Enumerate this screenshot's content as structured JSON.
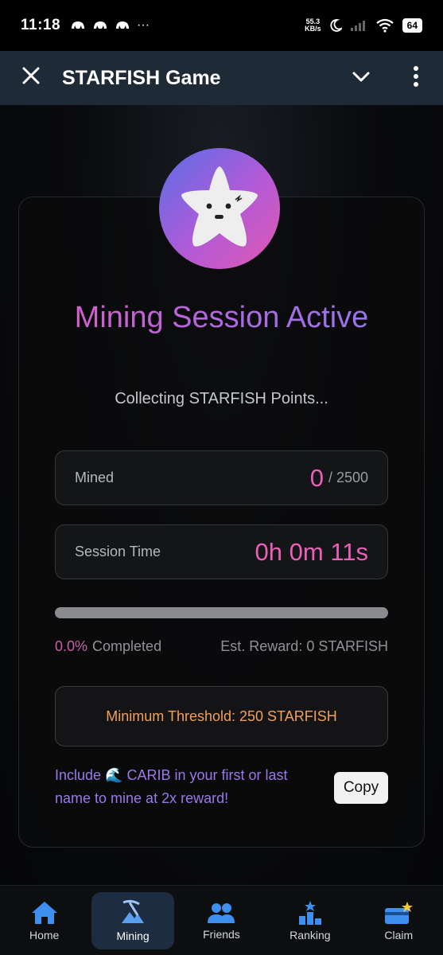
{
  "status_bar": {
    "time": "11:18",
    "notifications": [
      "app-icon",
      "app-icon",
      "app-icon"
    ],
    "more": "···",
    "net_speed_value": "55.3",
    "net_speed_unit": "KB/s",
    "battery": "64"
  },
  "header": {
    "title": "STARFISH Game"
  },
  "main": {
    "headline": "Mining Session Active",
    "subtitle": "Collecting STARFISH Points...",
    "mined": {
      "label": "Mined",
      "value": "0",
      "total": "/ 2500"
    },
    "session_time": {
      "label": "Session Time",
      "value": "0h 0m 11s"
    },
    "progress": {
      "fraction": 0.0,
      "percent_label": "0.0%",
      "completed_label": "Completed",
      "est_reward_label": "Est. Reward: 0 STARFISH"
    },
    "threshold": "Minimum Threshold: 250 STARFISH",
    "promo_text": "Include 🌊 CARIB in your first or last name to mine at 2x reward!",
    "copy_button": "Copy"
  },
  "bottom_nav": [
    {
      "label": "Home",
      "icon": "home-icon",
      "active": false
    },
    {
      "label": "Mining",
      "icon": "mining-icon",
      "active": true
    },
    {
      "label": "Friends",
      "icon": "friends-icon",
      "active": false
    },
    {
      "label": "Ranking",
      "icon": "ranking-icon",
      "active": false
    },
    {
      "label": "Claim",
      "icon": "claim-icon",
      "active": false
    }
  ],
  "colors": {
    "accent_pink": "#ec5fb8",
    "accent_purple": "#9a78ec",
    "threshold_orange": "#f0a05a",
    "header_bg": "#1e2a35",
    "nav_active_bg": "#1d2c40"
  }
}
